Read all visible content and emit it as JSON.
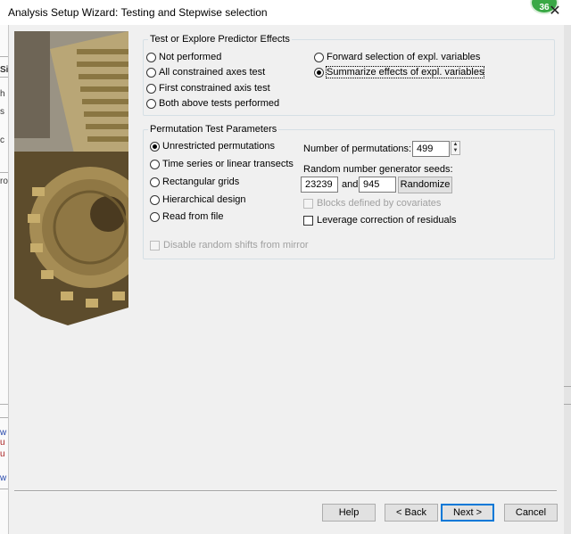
{
  "window": {
    "title": "Analysis Setup Wizard: Testing and Stepwise selection",
    "close_glyph": "✕",
    "badge": "36",
    "left_edge_chars": [
      "Si",
      "h",
      "s",
      "c",
      "ro",
      "w",
      "u",
      "u",
      "w"
    ]
  },
  "effects": {
    "legend": "Test or Explore Predictor Effects",
    "options": [
      {
        "label": "Not performed",
        "selected": false
      },
      {
        "label": "All constrained axes test",
        "selected": false
      },
      {
        "label": "First constrained axis test",
        "selected": false
      },
      {
        "label": "Both above tests performed",
        "selected": false
      },
      {
        "label": "Forward selection of expl. variables",
        "selected": false
      },
      {
        "label": "Summarize effects of expl. variables",
        "selected": true
      }
    ]
  },
  "permutation": {
    "legend": "Permutation Test Parameters",
    "options": [
      {
        "label": "Unrestricted permutations",
        "selected": true
      },
      {
        "label": "Time series or linear transects",
        "selected": false
      },
      {
        "label": "Rectangular grids",
        "selected": false
      },
      {
        "label": "Hierarchical design",
        "selected": false
      },
      {
        "label": "Read from file",
        "selected": false
      }
    ],
    "num_label": "Number of permutations:",
    "num_value": "499",
    "seeds_label": "Random number generator seeds:",
    "seed1": "23239",
    "and_label": "and",
    "seed2": "945",
    "randomize_label": "Randomize",
    "blocks_label": "Blocks defined by covariates",
    "blocks_checked": false,
    "blocks_enabled": false,
    "leverage_label": "Leverage correction of residuals",
    "leverage_checked": false,
    "mirror_label": "Disable random shifts from mirror",
    "mirror_checked": false
  },
  "buttons": {
    "help": "Help",
    "back": "< Back",
    "next": "Next >",
    "cancel": "Cancel"
  },
  "colors": {
    "badge": "#39a845",
    "default_button_border": "#0078d7",
    "group_border": "#d5dfe5"
  },
  "icons": {
    "close": "close-icon",
    "spin_up": "spin-up-icon",
    "spin_down": "spin-down-icon"
  }
}
